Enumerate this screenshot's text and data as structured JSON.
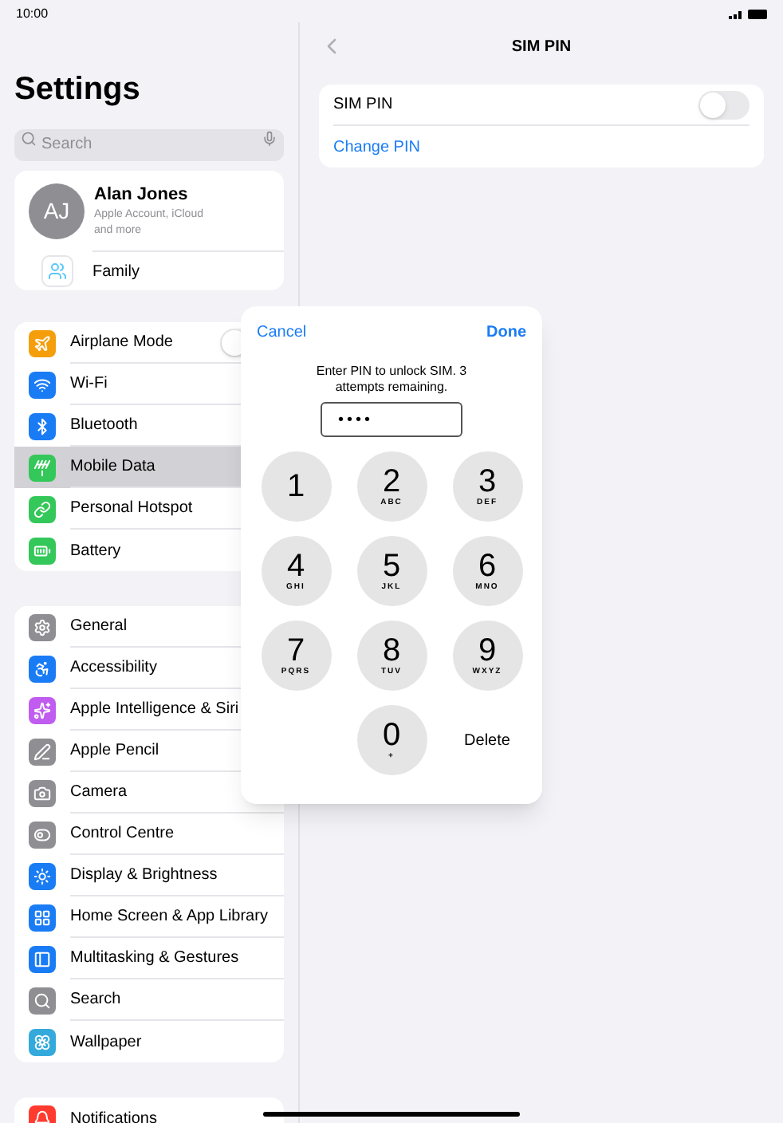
{
  "status_bar": {
    "time": "10:00"
  },
  "sidebar": {
    "title": "Settings",
    "search": {
      "placeholder": "Search"
    },
    "account": {
      "initials": "AJ",
      "name": "Alan Jones",
      "subtitle": "Apple Account, iCloud and more",
      "family": "Family"
    },
    "groups": [
      [
        {
          "label": "Airplane Mode",
          "kind": "toggle",
          "on": false,
          "selected": false
        },
        {
          "label": "Wi-Fi",
          "kind": "link",
          "selected": false
        },
        {
          "label": "Bluetooth",
          "kind": "link",
          "selected": false
        },
        {
          "label": "Mobile Data",
          "kind": "link",
          "selected": true
        },
        {
          "label": "Personal Hotspot",
          "kind": "link",
          "selected": false
        },
        {
          "label": "Battery",
          "kind": "link",
          "selected": false
        }
      ],
      [
        {
          "label": "General",
          "kind": "link",
          "selected": false
        },
        {
          "label": "Accessibility",
          "kind": "link",
          "selected": false
        },
        {
          "label": "Apple Intelligence & Siri",
          "kind": "link",
          "selected": false
        },
        {
          "label": "Apple Pencil",
          "kind": "link",
          "selected": false
        },
        {
          "label": "Camera",
          "kind": "link",
          "selected": false
        },
        {
          "label": "Control Centre",
          "kind": "link",
          "selected": false
        },
        {
          "label": "Display & Brightness",
          "kind": "link",
          "selected": false
        },
        {
          "label": "Home Screen & App Library",
          "kind": "link",
          "selected": false
        },
        {
          "label": "Multitasking & Gestures",
          "kind": "link",
          "selected": false
        },
        {
          "label": "Search",
          "kind": "link",
          "selected": false
        },
        {
          "label": "Wallpaper",
          "kind": "link",
          "selected": false
        }
      ],
      [
        {
          "label": "Notifications",
          "kind": "link",
          "selected": false
        }
      ]
    ]
  },
  "detail": {
    "title": "SIM PIN",
    "rows": [
      {
        "label": "SIM PIN",
        "kind": "toggle",
        "on": false
      },
      {
        "label": "Change PIN",
        "kind": "action"
      }
    ]
  },
  "pin_dialog": {
    "cancel": "Cancel",
    "done": "Done",
    "message": "Enter PIN to unlock SIM. 3 attempts remaining.",
    "value": "••••",
    "keys": [
      {
        "digit": "1",
        "kind": "digit"
      },
      {
        "digit": "2",
        "letters": "ABC",
        "kind": "digit"
      },
      {
        "digit": "3",
        "letters": "DEF",
        "kind": "digit"
      },
      {
        "digit": "4",
        "letters": "GHI",
        "kind": "digit"
      },
      {
        "digit": "5",
        "letters": "JKL",
        "kind": "digit"
      },
      {
        "digit": "6",
        "letters": "MNO",
        "kind": "digit"
      },
      {
        "digit": "7",
        "letters": "PQRS",
        "kind": "digit"
      },
      {
        "digit": "8",
        "letters": "TUV",
        "kind": "digit"
      },
      {
        "digit": "9",
        "letters": "WXYZ",
        "kind": "digit"
      },
      {
        "kind": "blank"
      },
      {
        "digit": "0",
        "letters": "+",
        "kind": "digit"
      },
      {
        "label": "Delete",
        "kind": "text"
      }
    ]
  }
}
